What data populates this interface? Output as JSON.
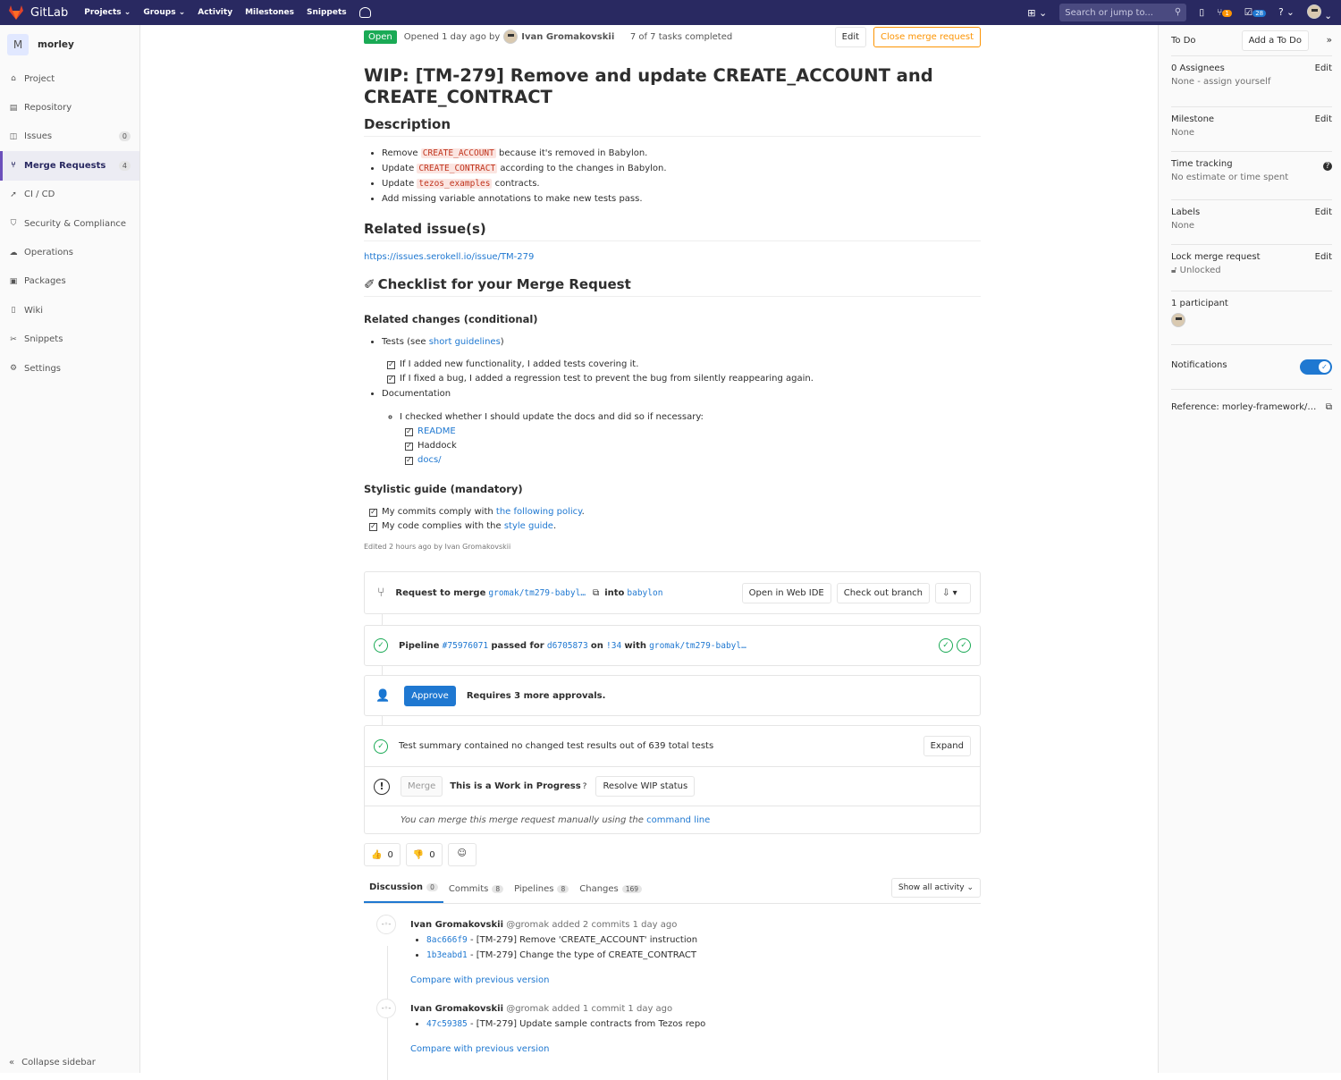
{
  "topnav": {
    "brand": "GitLab",
    "menu": [
      "Projects",
      "Groups",
      "Activity",
      "Milestones",
      "Snippets"
    ],
    "search_placeholder": "Search or jump to...",
    "mr_count": "1",
    "todo_count": "28"
  },
  "sidebar": {
    "project_initial": "M",
    "project_name": "morley",
    "items": [
      {
        "label": "Project",
        "icon": "home-icon"
      },
      {
        "label": "Repository",
        "icon": "repo-icon"
      },
      {
        "label": "Issues",
        "icon": "issues-icon",
        "count": "0"
      },
      {
        "label": "Merge Requests",
        "icon": "merge-request-icon",
        "count": "4"
      },
      {
        "label": "CI / CD",
        "icon": "rocket-icon"
      },
      {
        "label": "Security & Compliance",
        "icon": "shield-icon"
      },
      {
        "label": "Operations",
        "icon": "cloud-icon"
      },
      {
        "label": "Packages",
        "icon": "package-icon"
      },
      {
        "label": "Wiki",
        "icon": "book-icon"
      },
      {
        "label": "Snippets",
        "icon": "scissors-icon"
      },
      {
        "label": "Settings",
        "icon": "gear-icon"
      }
    ],
    "collapse": "Collapse sidebar"
  },
  "mr": {
    "status": "Open",
    "opened": "Opened 1 day ago by",
    "author": "Ivan Gromakovskii",
    "tasks": "7 of 7 tasks completed",
    "edit": "Edit",
    "close": "Close merge request",
    "title": "WIP: [TM-279] Remove and update CREATE_ACCOUNT and CREATE_CONTRACT"
  },
  "desc": {
    "heading": "Description",
    "b1_pre": "Remove",
    "b1_code": "CREATE_ACCOUNT",
    "b1_post": "because it's removed in Babylon.",
    "b2_pre": "Update",
    "b2_code": "CREATE_CONTRACT",
    "b2_post": "according to the changes in Babylon.",
    "b3_pre": "Update",
    "b3_code": "tezos_examples",
    "b3_post": "contracts.",
    "b4": "Add missing variable annotations to make new tests pass.",
    "related_heading": "Related issue(s)",
    "related_link": "https://issues.serokell.io/issue/TM-279",
    "checklist_heading": "Checklist for your Merge Request",
    "rc_heading": "Related changes (conditional)",
    "tests_pre": "Tests (see",
    "tests_link": "short guidelines",
    "tests_post": ")",
    "t1": "If I added new functionality, I added tests covering it.",
    "t2": "If I fixed a bug, I added a regression test to prevent the bug from silently reappearing again.",
    "docs": "Documentation",
    "docs_sub": "I checked whether I should update the docs and did so if necessary:",
    "d1": "README",
    "d2": "Haddock",
    "d3": "docs/",
    "sg_heading": "Stylistic guide (mandatory)",
    "s1_pre": "My commits comply with",
    "s1_link": "the following policy",
    "s1_post": ".",
    "s2_pre": "My code complies with the",
    "s2_link": "style guide",
    "s2_post": ".",
    "edited": "Edited 2 hours ago by Ivan Gromakovskii"
  },
  "widget": {
    "req_pre": "Request to merge",
    "source": "gromak/tm279-babyl…",
    "into": "into",
    "target": "babylon",
    "web_ide": "Open in Web IDE",
    "checkout": "Check out branch",
    "pipeline_pre": "Pipeline",
    "pipeline_id": "#75976071",
    "passed_for": "passed for",
    "commit": "d6705873",
    "on": "on",
    "mr_ref": "!34",
    "with": "with",
    "branch": "gromak/tm279-babyl…",
    "approve": "Approve",
    "approvals": "Requires 3 more approvals.",
    "test_summary": "Test summary contained no changed test results out of 639 total tests",
    "expand": "Expand",
    "merge": "Merge",
    "wip": "This is a Work in Progress",
    "resolve_wip": "Resolve WIP status",
    "manual_pre": "You can merge this merge request manually using the",
    "manual_link": "command line"
  },
  "awards": {
    "up": "0",
    "down": "0"
  },
  "tabs": [
    {
      "label": "Discussion",
      "count": "0"
    },
    {
      "label": "Commits",
      "count": "8"
    },
    {
      "label": "Pipelines",
      "count": "8"
    },
    {
      "label": "Changes",
      "count": "169"
    }
  ],
  "activity_filter": "Show all activity",
  "notes": [
    {
      "author": "Ivan Gromakovskii",
      "handle": "@gromak",
      "action": "added 2 commits 1 day ago",
      "commits": [
        {
          "sha": "8ac666f9",
          "msg": "- [TM-279] Remove 'CREATE_ACCOUNT' instruction"
        },
        {
          "sha": "1b3eabd1",
          "msg": "- [TM-279] Change the type of CREATE_CONTRACT"
        }
      ],
      "compare": "Compare with previous version"
    },
    {
      "author": "Ivan Gromakovskii",
      "handle": "@gromak",
      "action": "added 1 commit 1 day ago",
      "commits": [
        {
          "sha": "47c59385",
          "msg": "- [TM-279] Update sample contracts from Tezos repo"
        }
      ],
      "compare": "Compare with previous version"
    }
  ],
  "rside": {
    "todo": "To Do",
    "add_todo": "Add a To Do",
    "assignees": "0 Assignees",
    "assign_none": "None - assign yourself",
    "edit": "Edit",
    "milestone": "Milestone",
    "milestone_val": "None",
    "time": "Time tracking",
    "time_val": "No estimate or time spent",
    "labels": "Labels",
    "labels_val": "None",
    "lock": "Lock merge request",
    "lock_val": "Unlocked",
    "participants": "1 participant",
    "notifications": "Notifications",
    "reference": "Reference: morley-framework/…"
  },
  "colors": {
    "nav": "#292961",
    "open": "#1aaa55",
    "link": "#1f78d1",
    "warn": "#fc9403"
  }
}
